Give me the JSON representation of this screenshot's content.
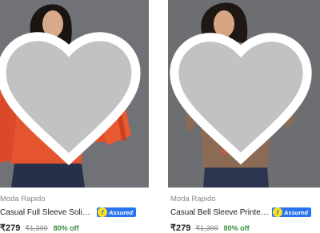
{
  "products": [
    {
      "brand": "Moda Rapido",
      "title": "Casual Full Sleeve Solid Wo...",
      "assured_label": "Assured",
      "price": "₹279",
      "mrp": "₹1,399",
      "discount": "80% off"
    },
    {
      "brand": "Moda Rapido",
      "title": "Casual Bell Sleeve Printed ...",
      "assured_label": "Assured",
      "price": "₹279",
      "mrp": "₹1,399",
      "discount": "80% off"
    }
  ],
  "icons": {
    "wishlist": "heart-icon",
    "assured_badge": "f-assured-icon"
  },
  "colors": {
    "assured_blue": "#2874f0",
    "discount_green": "#388e3c",
    "muted_text": "#878787"
  }
}
